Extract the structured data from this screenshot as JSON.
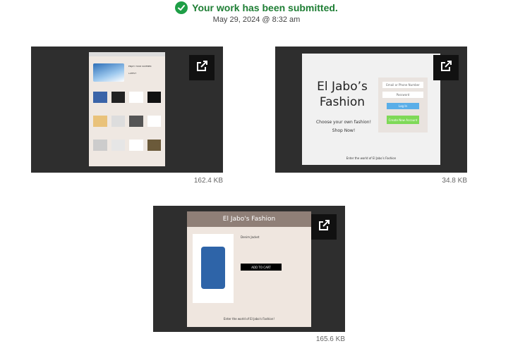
{
  "status": {
    "message": "Your work has been submitted.",
    "timestamp": "May 29, 2024 @ 8:32 am",
    "color": "#1e9e46"
  },
  "submissions": [
    {
      "size": "162.4 KB",
      "icon": "external-link-icon",
      "preview": {
        "header_text": "ENJOY YOUR SUMMER",
        "sub_text": "LATEST"
      }
    },
    {
      "size": "34.8 KB",
      "icon": "external-link-icon",
      "preview": {
        "title": "El Jabo’s Fashion",
        "tagline": "Choose your own fashion!",
        "cta": "Shop Now!",
        "email_placeholder": "Email or Phone Number",
        "password_placeholder": "Password",
        "login": "Log In",
        "create": "Create New Account",
        "footer": "Enter the world of El Jabo’s Fashion"
      }
    },
    {
      "size": "165.6 KB",
      "icon": "external-link-icon",
      "preview": {
        "title": "El Jabo's Fashion",
        "product": "Denim Jacket",
        "button": "ADD TO CART",
        "footer": "Enter the world of El Jabo's Fashion!"
      }
    }
  ]
}
